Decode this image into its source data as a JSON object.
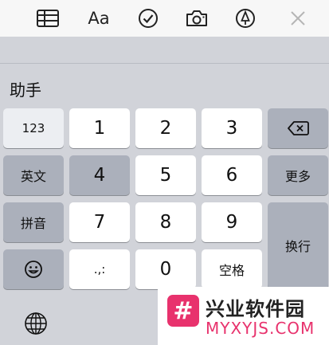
{
  "toolbar": {
    "icons": [
      "table-icon",
      "text-format-icon",
      "checklist-icon",
      "camera-icon",
      "markup-pen-icon",
      "close-icon"
    ],
    "text_format_label": "Aa"
  },
  "candidate": {
    "text": "助手"
  },
  "keys": {
    "k123": "123",
    "k1": "1",
    "k2": "2",
    "k3": "3",
    "english": "英文",
    "k4": "4",
    "k5": "5",
    "k6": "6",
    "more": "更多",
    "pinyin": "拼音",
    "k7": "7",
    "k8": "8",
    "k9": "9",
    "return": "换行",
    "punct": ".,:",
    "k0": "0",
    "space": "空格"
  },
  "watermark": {
    "name": "兴业软件园",
    "site": "MYXYJS.COM",
    "logo": "#"
  },
  "colors": {
    "accent": "#e8326d"
  }
}
